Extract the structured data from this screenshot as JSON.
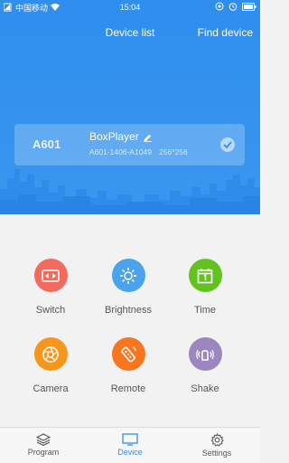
{
  "status_bar": {
    "carrier": "中国移动",
    "time": "15:04",
    "battery_icon": "battery-icon"
  },
  "nav": {
    "title": "Device list",
    "action": "Find device"
  },
  "device": {
    "model": "A601",
    "name": "BoxPlayer",
    "serial": "A601-1406-A1049",
    "resolution": "256*256",
    "selected": true
  },
  "functions": [
    {
      "label": "Switch",
      "color": "#f26b5e",
      "icon": "power-switch-icon"
    },
    {
      "label": "Brightness",
      "color": "#4aa3ec",
      "icon": "sun-icon"
    },
    {
      "label": "Time",
      "color": "#63c31e",
      "icon": "calendar-icon"
    },
    {
      "label": "Camera",
      "color": "#f7961d",
      "icon": "camera-aperture-icon"
    },
    {
      "label": "Remote",
      "color": "#f7761f",
      "icon": "remote-control-icon"
    },
    {
      "label": "Shake",
      "color": "#9b86bf",
      "icon": "shake-icon"
    }
  ],
  "tabs": [
    {
      "label": "Program",
      "icon": "layers-icon",
      "active": false
    },
    {
      "label": "Device",
      "icon": "monitor-icon",
      "active": true
    },
    {
      "label": "Settings",
      "icon": "gear-icon",
      "active": false
    }
  ],
  "colors": {
    "primary": "#2f8eee",
    "background": "#f2f2f2"
  }
}
